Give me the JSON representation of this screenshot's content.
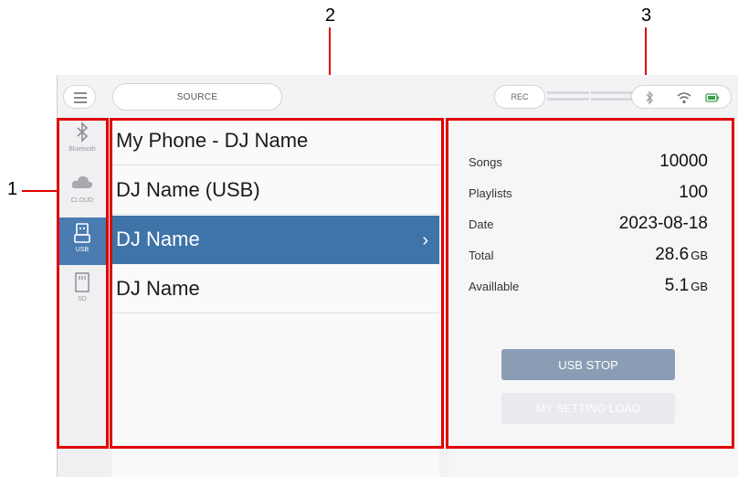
{
  "callouts": {
    "one": "1",
    "two": "2",
    "three": "3"
  },
  "topbar": {
    "source_label": "SOURCE",
    "rec_label": "REC"
  },
  "sidebar": {
    "items": [
      {
        "label": "Bluetooth",
        "icon": "bluetooth-icon"
      },
      {
        "label": "CLOUD",
        "icon": "cloud-icon"
      },
      {
        "label": "USB",
        "icon": "usb-icon",
        "active": true
      },
      {
        "label": "SD",
        "icon": "sd-card-icon"
      }
    ]
  },
  "device_list": {
    "items": [
      {
        "label": "My Phone - DJ Name"
      },
      {
        "label": "DJ Name (USB)"
      },
      {
        "label": "DJ Name",
        "selected": true
      },
      {
        "label": "DJ Name"
      }
    ],
    "chevron": "›"
  },
  "info": {
    "rows": [
      {
        "key": "Songs",
        "value": "10000",
        "unit": ""
      },
      {
        "key": "Playlists",
        "value": "100",
        "unit": ""
      },
      {
        "key": "Date",
        "value": "2023-08-18",
        "unit": ""
      },
      {
        "key": "Total",
        "value": "28.6",
        "unit": "GB"
      },
      {
        "key": "Availlable",
        "value": "5.1",
        "unit": "GB"
      }
    ],
    "usb_stop_label": "USB STOP",
    "my_setting_load_label": "MY SETTING LOAD"
  },
  "colors": {
    "accent": "#3f74a9",
    "callout": "#e00000"
  }
}
